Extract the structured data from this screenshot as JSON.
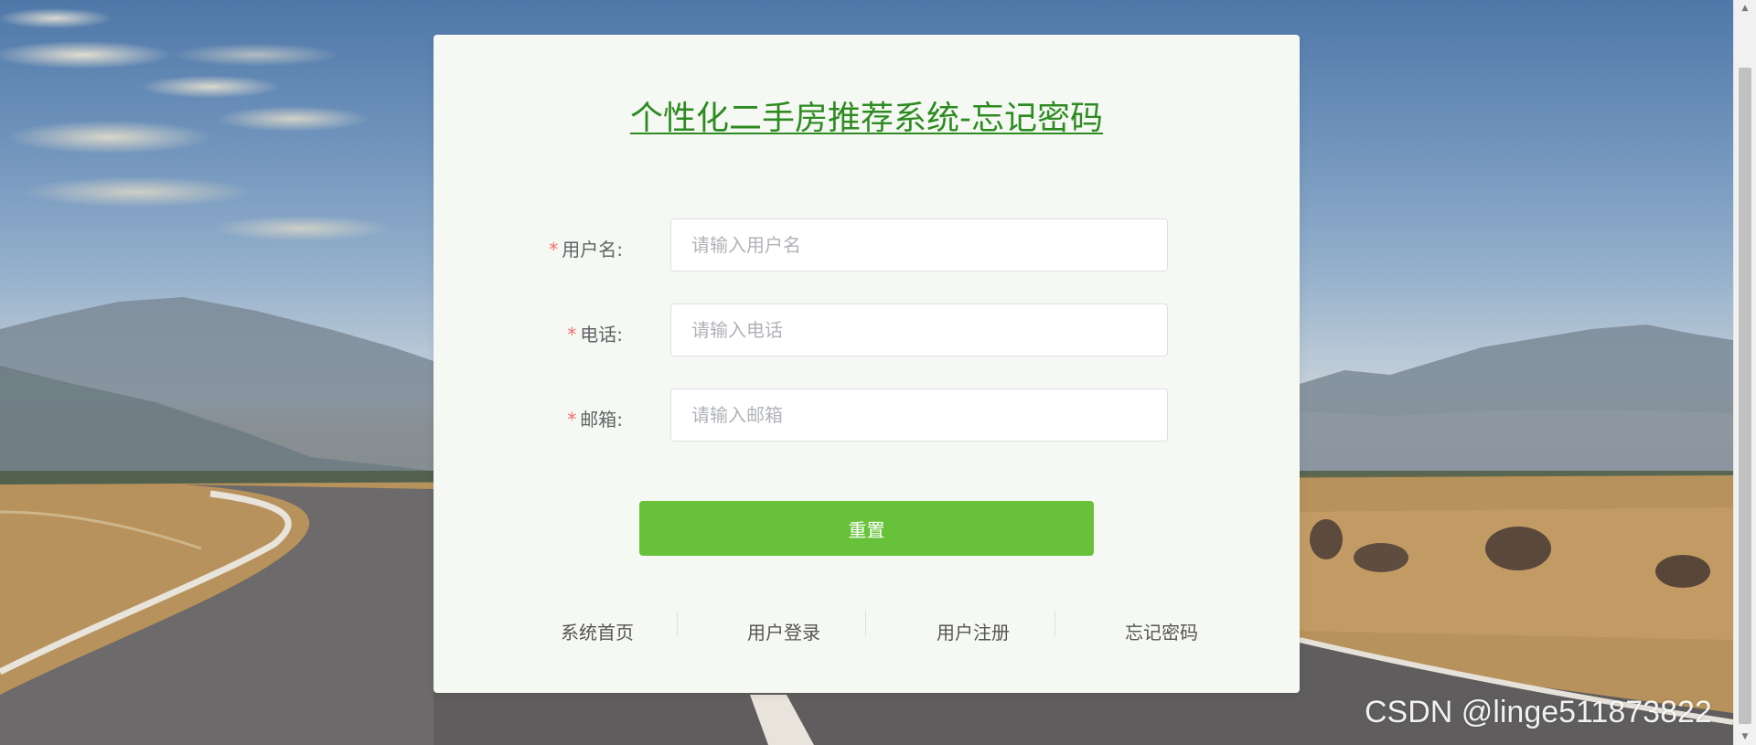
{
  "page": {
    "title": "个性化二手房推荐系统-忘记密码"
  },
  "form": {
    "username": {
      "label": "用户名:",
      "required_mark": "*",
      "placeholder": "请输入用户名",
      "value": ""
    },
    "phone": {
      "label": "电话:",
      "required_mark": "*",
      "placeholder": "请输入电话",
      "value": ""
    },
    "email": {
      "label": "邮箱:",
      "required_mark": "*",
      "placeholder": "请输入邮箱",
      "value": ""
    },
    "reset_label": "重置"
  },
  "links": [
    {
      "label": "系统首页"
    },
    {
      "label": "用户登录"
    },
    {
      "label": "用户注册"
    },
    {
      "label": "忘记密码"
    }
  ],
  "watermark": "CSDN @linge511873822",
  "colors": {
    "title": "#2e8b22",
    "primary_button": "#67c23a",
    "required": "#f56c6c",
    "card_background": "#f6f9f3"
  },
  "icons": {
    "scroll_up": "triangle-up",
    "scroll_down": "triangle-down"
  }
}
